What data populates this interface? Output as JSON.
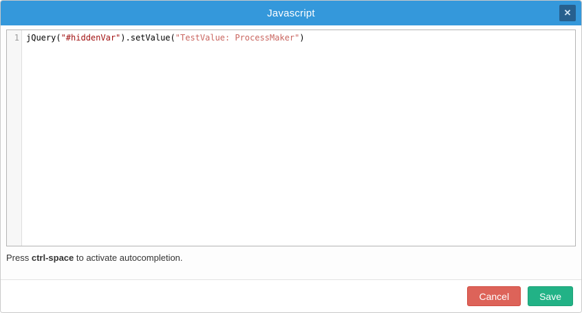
{
  "header": {
    "title": "Javascript",
    "close_glyph": "✕"
  },
  "editor": {
    "line_number": "1",
    "code": {
      "t1": "jQuery(",
      "s1": "\"#hiddenVar\"",
      "t2": ").setValue(",
      "s2": "\"TestValue: ProcessMaker\"",
      "t3": ")"
    }
  },
  "hint": {
    "prefix": "Press ",
    "key": "ctrl-space",
    "suffix": " to activate autocompletion."
  },
  "footer": {
    "cancel_label": "Cancel",
    "save_label": "Save"
  },
  "colors": {
    "header_bg": "#3498db",
    "close_button_bg": "#27608e",
    "editor_border": "#b3b3b3",
    "gutter_bg": "#f7f7f7",
    "line_number_color": "#999999",
    "string_1_color": "#a11111",
    "string_2_color": "#c9655f",
    "cancel_button_bg": "#dd6359",
    "save_button_bg": "#22b286"
  }
}
